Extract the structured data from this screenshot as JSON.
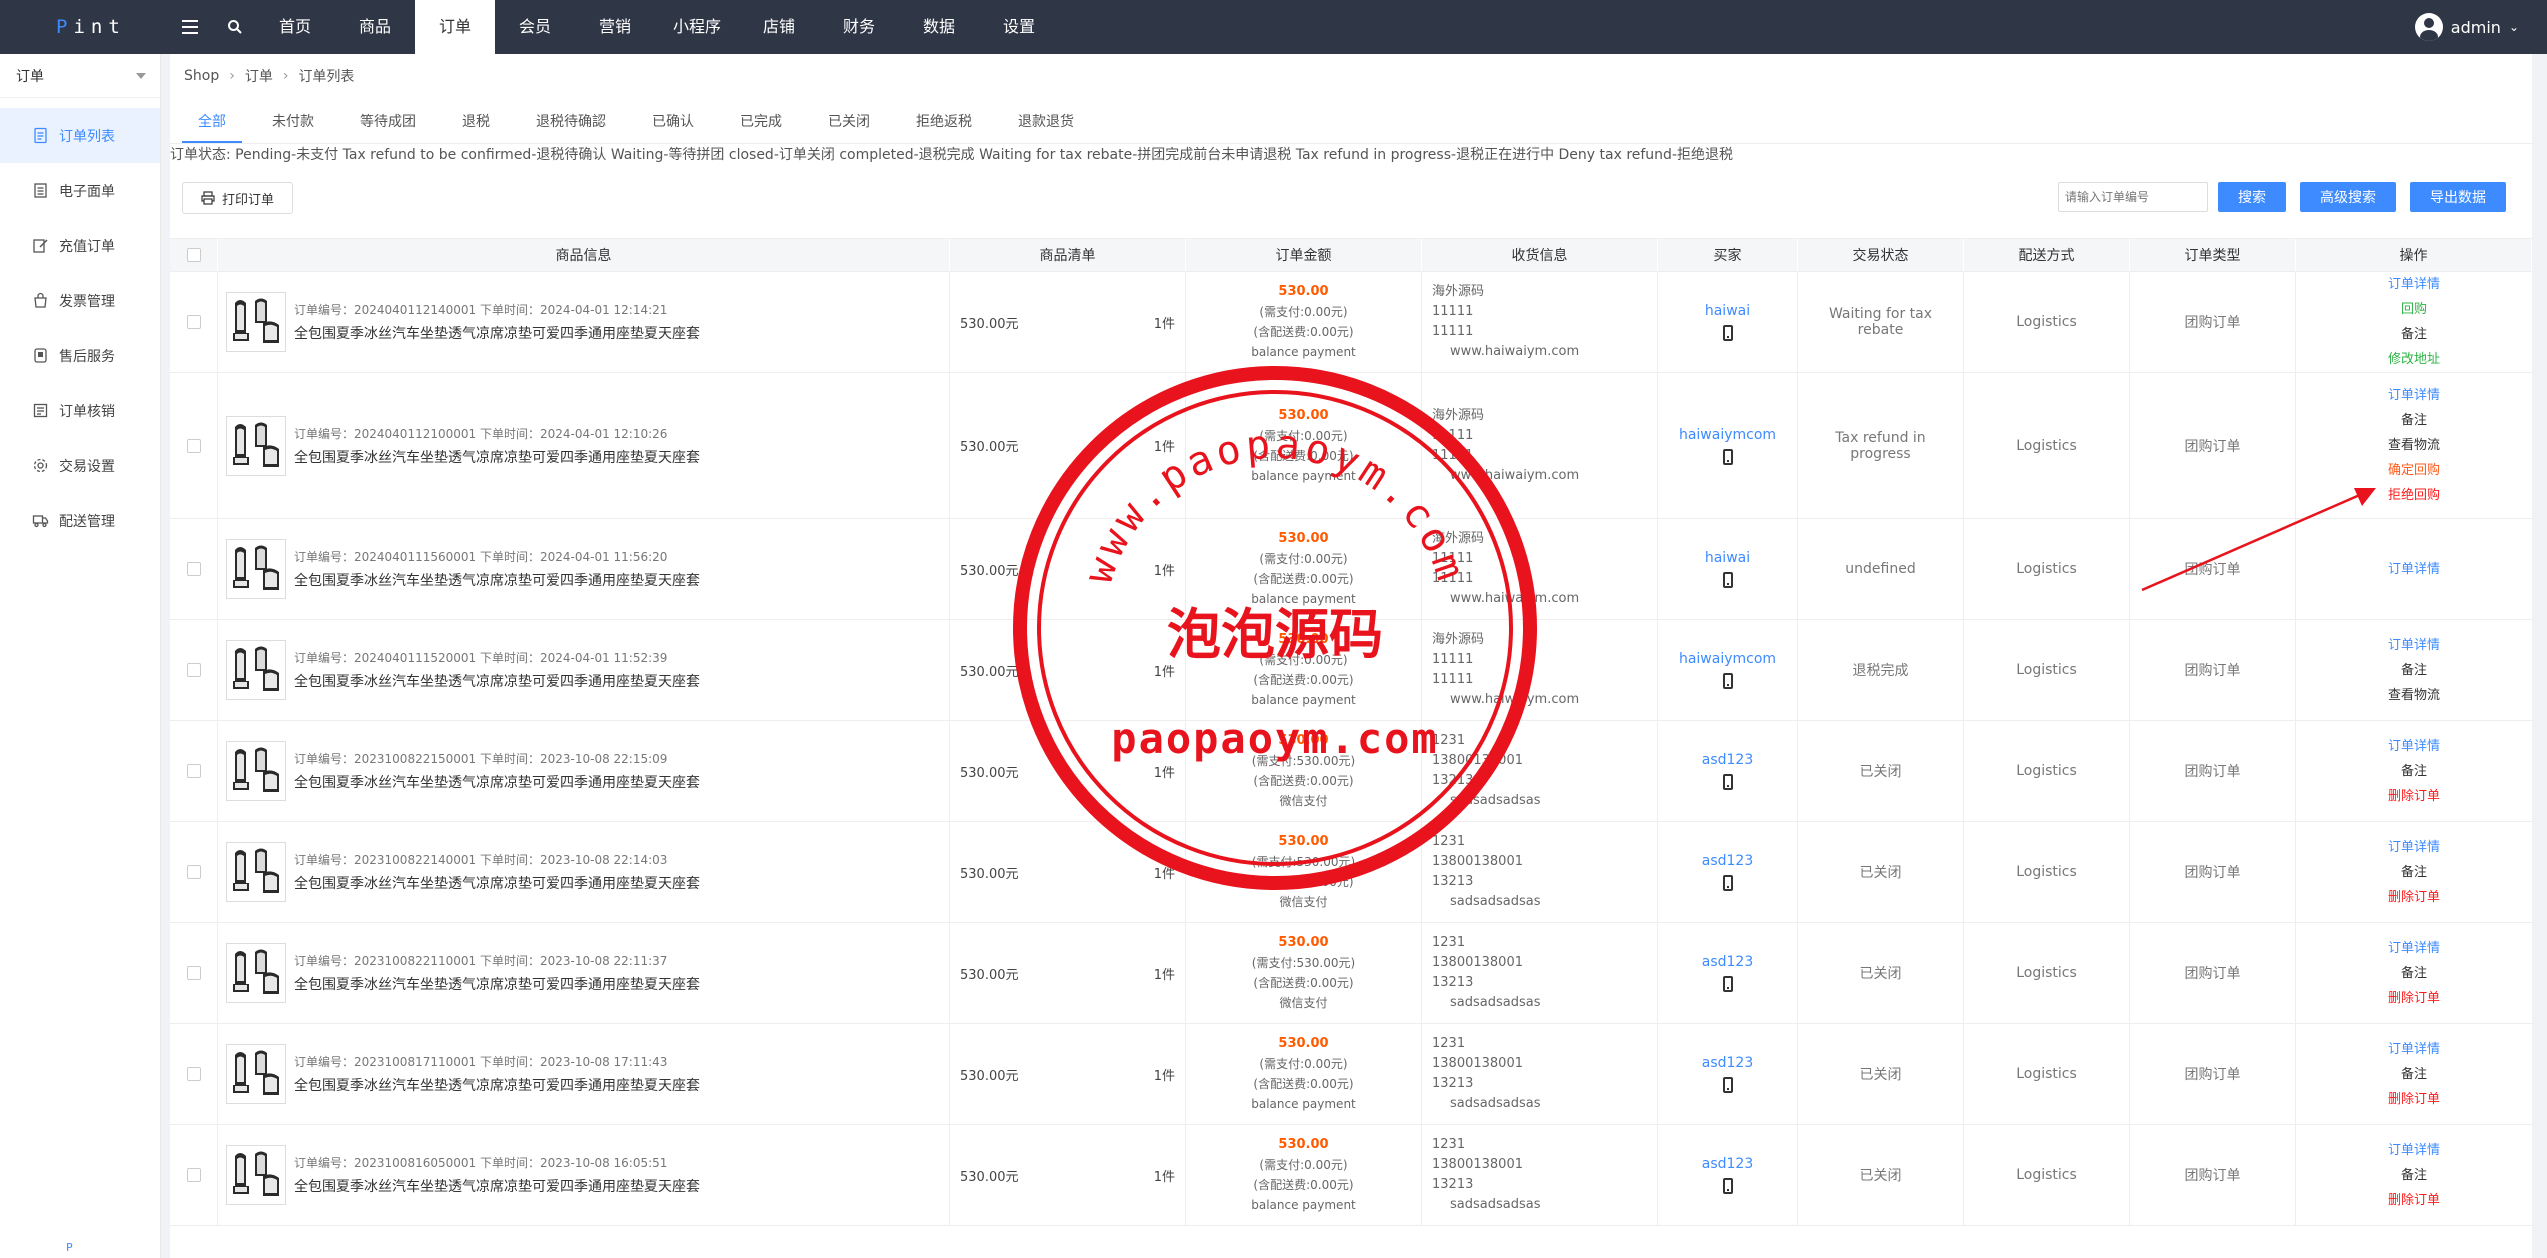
{
  "app": {
    "logo": "Pint",
    "nav": [
      "首页",
      "商品",
      "订单",
      "会员",
      "营销",
      "小程序",
      "店铺",
      "财务",
      "数据",
      "设置"
    ],
    "nav_active": "订单",
    "user": "admin"
  },
  "sidebar": {
    "title": "订单",
    "items": [
      {
        "label": "订单列表",
        "icon": "document-icon"
      },
      {
        "label": "电子面单",
        "icon": "list-icon"
      },
      {
        "label": "充值订单",
        "icon": "edit-icon"
      },
      {
        "label": "发票管理",
        "icon": "bag-icon"
      },
      {
        "label": "售后服务",
        "icon": "stack-icon"
      },
      {
        "label": "订单核销",
        "icon": "checklist-icon"
      },
      {
        "label": "交易设置",
        "icon": "gear-icon"
      },
      {
        "label": "配送管理",
        "icon": "truck-icon"
      }
    ],
    "footer": "P"
  },
  "breadcrumb": [
    "Shop",
    "订单",
    "订单列表"
  ],
  "tabs": [
    "全部",
    "未付款",
    "等待成团",
    "退税",
    "退税待确認",
    "已确认",
    "已完成",
    "已关闭",
    "拒绝返税",
    "退款退货"
  ],
  "status_note": "订单状态: Pending-未支付 Tax refund to be confirmed-退税待确认 Waiting-等待拼团 closed-订单关闭 completed-退税完成 Waiting for tax rebate-拼团完成前台未申请退税 Tax refund in progress-退税正在进行中 Deny tax refund-拒绝退税",
  "toolbar": {
    "print_label": "打印订单",
    "search_placeholder": "请输入订单编号",
    "search_label": "搜索",
    "advanced_label": "高级搜索",
    "export_label": "导出数据"
  },
  "columns": [
    "商品信息",
    "商品清单",
    "订单金额",
    "收货信息",
    "买家",
    "交易状态",
    "配送方式",
    "订单类型",
    "操作"
  ],
  "orders": [
    {
      "order_no": "订单编号：2024040112140001 下单时间：2024-04-01 12:14:21",
      "title": "全包围夏季冰丝汽车坐垫透气凉席凉垫可爱四季通用座垫夏天座套",
      "price": "530.00元",
      "qty": "1件",
      "total": "530.00",
      "paid": "(需支付:0.00元)",
      "freight": "(含配送费:0.00元)",
      "pay_method": "balance payment",
      "ship": [
        "海外源码",
        "11111",
        "11111",
        "www.haiwaiym.com"
      ],
      "buyer": "haiwai",
      "status": "Waiting for tax rebate",
      "delivery": "Logistics",
      "type": "团购订单",
      "ops": [
        {
          "label": "订单详情",
          "color": "blue"
        },
        {
          "label": "回购",
          "color": "green"
        },
        {
          "label": "备注",
          "color": "black"
        },
        {
          "label": "修改地址",
          "color": "green"
        }
      ]
    },
    {
      "order_no": "订单编号：2024040112100001 下单时间：2024-04-01 12:10:26",
      "title": "全包围夏季冰丝汽车坐垫透气凉席凉垫可爱四季通用座垫夏天座套",
      "price": "530.00元",
      "qty": "1件",
      "total": "530.00",
      "paid": "(需支付:0.00元)",
      "freight": "(含配送费:0.00元)",
      "pay_method": "balance payment",
      "ship": [
        "海外源码",
        "11111",
        "11111",
        "www.haiwaiym.com"
      ],
      "buyer": "haiwaiymcom",
      "status": "Tax refund in progress",
      "delivery": "Logistics",
      "type": "团购订单",
      "ops": [
        {
          "label": "订单详情",
          "color": "blue"
        },
        {
          "label": "备注",
          "color": "black"
        },
        {
          "label": "查看物流",
          "color": "black"
        },
        {
          "label": "确定回购",
          "color": "orange"
        },
        {
          "label": "拒绝回购",
          "color": "red"
        }
      ]
    },
    {
      "order_no": "订单编号：2024040111560001 下单时间：2024-04-01 11:56:20",
      "title": "全包围夏季冰丝汽车坐垫透气凉席凉垫可爱四季通用座垫夏天座套",
      "price": "530.00元",
      "qty": "1件",
      "total": "530.00",
      "paid": "(需支付:0.00元)",
      "freight": "(含配送费:0.00元)",
      "pay_method": "balance payment",
      "ship": [
        "海外源码",
        "11111",
        "11111",
        "www.haiwaiym.com"
      ],
      "buyer": "haiwai",
      "status": "undefined",
      "delivery": "Logistics",
      "type": "团购订单",
      "ops": [
        {
          "label": "订单详情",
          "color": "blue"
        }
      ]
    },
    {
      "order_no": "订单编号：2024040111520001 下单时间：2024-04-01 11:52:39",
      "title": "全包围夏季冰丝汽车坐垫透气凉席凉垫可爱四季通用座垫夏天座套",
      "price": "530.00元",
      "qty": "1件",
      "total": "530.00",
      "paid": "(需支付:0.00元)",
      "freight": "(含配送费:0.00元)",
      "pay_method": "balance payment",
      "ship": [
        "海外源码",
        "11111",
        "11111",
        "www.haiwaiym.com"
      ],
      "buyer": "haiwaiymcom",
      "status": "退税完成",
      "delivery": "Logistics",
      "type": "团购订单",
      "ops": [
        {
          "label": "订单详情",
          "color": "blue"
        },
        {
          "label": "备注",
          "color": "black"
        },
        {
          "label": "查看物流",
          "color": "black"
        }
      ]
    },
    {
      "order_no": "订单编号：2023100822150001 下单时间：2023-10-08 22:15:09",
      "title": "全包围夏季冰丝汽车坐垫透气凉席凉垫可爱四季通用座垫夏天座套",
      "price": "530.00元",
      "qty": "1件",
      "total": "530.00",
      "paid": "(需支付:530.00元)",
      "freight": "(含配送费:0.00元)",
      "pay_method": "微信支付",
      "ship": [
        "1231",
        "13800138001",
        "13213",
        "sadsadsadsas"
      ],
      "buyer": "asd123",
      "status": "已关闭",
      "delivery": "Logistics",
      "type": "团购订单",
      "ops": [
        {
          "label": "订单详情",
          "color": "blue"
        },
        {
          "label": "备注",
          "color": "black"
        },
        {
          "label": "删除订单",
          "color": "red"
        }
      ]
    },
    {
      "order_no": "订单编号：2023100822140001 下单时间：2023-10-08 22:14:03",
      "title": "全包围夏季冰丝汽车坐垫透气凉席凉垫可爱四季通用座垫夏天座套",
      "price": "530.00元",
      "qty": "1件",
      "total": "530.00",
      "paid": "(需支付:530.00元)",
      "freight": "(含配送费:0.00元)",
      "pay_method": "微信支付",
      "ship": [
        "1231",
        "13800138001",
        "13213",
        "sadsadsadsas"
      ],
      "buyer": "asd123",
      "status": "已关闭",
      "delivery": "Logistics",
      "type": "团购订单",
      "ops": [
        {
          "label": "订单详情",
          "color": "blue"
        },
        {
          "label": "备注",
          "color": "black"
        },
        {
          "label": "删除订单",
          "color": "red"
        }
      ]
    },
    {
      "order_no": "订单编号：2023100822110001 下单时间：2023-10-08 22:11:37",
      "title": "全包围夏季冰丝汽车坐垫透气凉席凉垫可爱四季通用座垫夏天座套",
      "price": "530.00元",
      "qty": "1件",
      "total": "530.00",
      "paid": "(需支付:530.00元)",
      "freight": "(含配送费:0.00元)",
      "pay_method": "微信支付",
      "ship": [
        "1231",
        "13800138001",
        "13213",
        "sadsadsadsas"
      ],
      "buyer": "asd123",
      "status": "已关闭",
      "delivery": "Logistics",
      "type": "团购订单",
      "ops": [
        {
          "label": "订单详情",
          "color": "blue"
        },
        {
          "label": "备注",
          "color": "black"
        },
        {
          "label": "删除订单",
          "color": "red"
        }
      ]
    },
    {
      "order_no": "订单编号：2023100817110001 下单时间：2023-10-08 17:11:43",
      "title": "全包围夏季冰丝汽车坐垫透气凉席凉垫可爱四季通用座垫夏天座套",
      "price": "530.00元",
      "qty": "1件",
      "total": "530.00",
      "paid": "(需支付:0.00元)",
      "freight": "(含配送费:0.00元)",
      "pay_method": "balance payment",
      "ship": [
        "1231",
        "13800138001",
        "13213",
        "sadsadsadsas"
      ],
      "buyer": "asd123",
      "status": "已关闭",
      "delivery": "Logistics",
      "type": "团购订单",
      "ops": [
        {
          "label": "订单详情",
          "color": "blue"
        },
        {
          "label": "备注",
          "color": "black"
        },
        {
          "label": "删除订单",
          "color": "red"
        }
      ]
    },
    {
      "order_no": "订单编号：2023100816050001 下单时间：2023-10-08 16:05:51",
      "title": "全包围夏季冰丝汽车坐垫透气凉席凉垫可爱四季通用座垫夏天座套",
      "price": "530.00元",
      "qty": "1件",
      "total": "530.00",
      "paid": "(需支付:0.00元)",
      "freight": "(含配送费:0.00元)",
      "pay_method": "balance payment",
      "ship": [
        "1231",
        "13800138001",
        "13213",
        "sadsadsadsas"
      ],
      "buyer": "asd123",
      "status": "已关闭",
      "delivery": "Logistics",
      "type": "团购订单",
      "ops": [
        {
          "label": "订单详情",
          "color": "blue"
        },
        {
          "label": "备注",
          "color": "black"
        },
        {
          "label": "删除订单",
          "color": "red"
        }
      ]
    }
  ],
  "watermark": {
    "arc_text": "www.paopaoym.com",
    "center_text": "泡泡源码",
    "bottom_text": "paopaoym.com",
    "color": "#e8131c"
  },
  "colors": {
    "accent": "#3d8bff",
    "topbar": "#2f3645",
    "price": "#ff5a00"
  }
}
